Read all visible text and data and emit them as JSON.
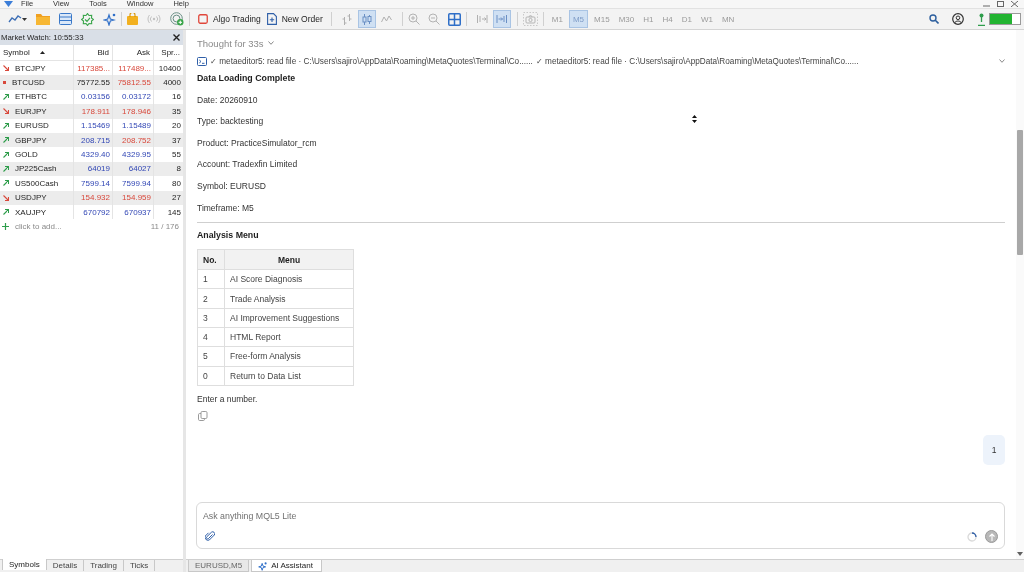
{
  "menu_bar": {
    "items": [
      "File",
      "View",
      "Tools",
      "Window",
      "Help"
    ]
  },
  "toolbar": {
    "algo_trading": {
      "label": "Algo Trading",
      "on": false
    },
    "new_order": {
      "label": "New Order"
    },
    "chart_types": [
      {
        "selected": false
      },
      {
        "selected": true
      },
      {
        "selected": false
      }
    ],
    "scroll_modes": [
      {
        "selected": false
      },
      {
        "selected": true
      }
    ],
    "timeframes": [
      {
        "label": "M1",
        "selected": false
      },
      {
        "label": "M5",
        "selected": true
      },
      {
        "label": "M15",
        "selected": false
      },
      {
        "label": "M30",
        "selected": false
      },
      {
        "label": "H1",
        "selected": false
      },
      {
        "label": "H4",
        "selected": false
      },
      {
        "label": "D1",
        "selected": false
      },
      {
        "label": "W1",
        "selected": false
      },
      {
        "label": "MN",
        "selected": false
      }
    ]
  },
  "market_watch": {
    "title": "Market Watch: 10:55:33",
    "columns": [
      {
        "label": "Symbol",
        "sorted": true
      },
      {
        "label": "Bid",
        "sorted": false
      },
      {
        "label": "Ask",
        "sorted": false
      },
      {
        "label": "Spr...",
        "sorted": false
      }
    ],
    "rows": [
      {
        "symbol": "BTCJPY",
        "kind": "falling",
        "bid": {
          "text": "117385...",
          "kind": "falling"
        },
        "ask": {
          "text": "117489...",
          "kind": "falling"
        },
        "spread": "10400"
      },
      {
        "symbol": "BTCUSD",
        "kind": "flat",
        "bid": {
          "text": "75772.55",
          "kind": "flat"
        },
        "ask": {
          "text": "75812.55",
          "kind": "falling"
        },
        "spread": "4000"
      },
      {
        "symbol": "ETHBTC",
        "kind": "rising",
        "bid": {
          "text": "0.03156",
          "kind": "rising"
        },
        "ask": {
          "text": "0.03172",
          "kind": "rising"
        },
        "spread": "16"
      },
      {
        "symbol": "EURJPY",
        "kind": "falling",
        "bid": {
          "text": "178.911",
          "kind": "falling"
        },
        "ask": {
          "text": "178.946",
          "kind": "falling"
        },
        "spread": "35"
      },
      {
        "symbol": "EURUSD",
        "kind": "rising",
        "bid": {
          "text": "1.15469",
          "kind": "rising"
        },
        "ask": {
          "text": "1.15489",
          "kind": "rising"
        },
        "spread": "20"
      },
      {
        "symbol": "GBPJPY",
        "kind": "rising",
        "bid": {
          "text": "208.715",
          "kind": "rising"
        },
        "ask": {
          "text": "208.752",
          "kind": "falling"
        },
        "spread": "37"
      },
      {
        "symbol": "GOLD",
        "kind": "rising",
        "bid": {
          "text": "4329.40",
          "kind": "rising"
        },
        "ask": {
          "text": "4329.95",
          "kind": "rising"
        },
        "spread": "55"
      },
      {
        "symbol": "JP225Cash",
        "kind": "rising",
        "bid": {
          "text": "64019",
          "kind": "rising"
        },
        "ask": {
          "text": "64027",
          "kind": "rising"
        },
        "spread": "8"
      },
      {
        "symbol": "US500Cash",
        "kind": "rising",
        "bid": {
          "text": "7599.14",
          "kind": "rising"
        },
        "ask": {
          "text": "7599.94",
          "kind": "rising"
        },
        "spread": "80"
      },
      {
        "symbol": "USDJPY",
        "kind": "falling",
        "bid": {
          "text": "154.932",
          "kind": "falling"
        },
        "ask": {
          "text": "154.959",
          "kind": "falling"
        },
        "spread": "27"
      },
      {
        "symbol": "XAUJPY",
        "kind": "rising",
        "bid": {
          "text": "670792",
          "kind": "rising"
        },
        "ask": {
          "text": "670937",
          "kind": "rising"
        },
        "spread": "145"
      }
    ],
    "add_label": "click to add...",
    "count": "11 / 176",
    "tabs": [
      {
        "label": "Symbols",
        "selected": true
      },
      {
        "label": "Details",
        "selected": false
      },
      {
        "label": "Trading",
        "selected": false
      },
      {
        "label": "Ticks",
        "selected": false
      }
    ]
  },
  "chat": {
    "thought_label": "Thought for 33s",
    "tool_calls": [
      "✓ metaeditor5: read file · C:\\Users\\sajiro\\AppData\\Roaming\\MetaQuotes\\Terminal\\Co......",
      "✓ metaeditor5: read file · C:\\Users\\sajiro\\AppData\\Roaming\\MetaQuotes\\Terminal\\Co......"
    ],
    "heading": "Data Loading Complete",
    "details": [
      "Date: 20260910",
      "Type: backtesting",
      "Product: PracticeSimulator_rcm",
      "Account: Tradexfin Limited",
      "Symbol: EURUSD",
      "Timeframe: M5"
    ],
    "section_title": "Analysis Menu",
    "menu_table": {
      "columns": [
        "No.",
        "Menu"
      ],
      "rows": [
        {
          "no": "1",
          "menu": "AI Score Diagnosis"
        },
        {
          "no": "2",
          "menu": "Trade Analysis"
        },
        {
          "no": "3",
          "menu": "AI Improvement Suggestions"
        },
        {
          "no": "4",
          "menu": "HTML Report"
        },
        {
          "no": "5",
          "menu": "Free-form Analysis"
        },
        {
          "no": "0",
          "menu": "Return to Data List"
        }
      ]
    },
    "prompt": "Enter a number.",
    "user_message": "1",
    "input": {
      "placeholder": "Ask anything MQL5 Lite"
    }
  },
  "document_tabs": [
    {
      "label": "EURUSD,M5",
      "selected": false
    },
    {
      "label": "AI Assistant",
      "selected": true
    }
  ]
}
